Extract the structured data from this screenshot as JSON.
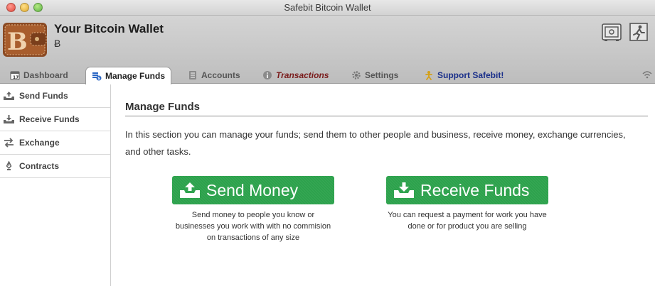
{
  "window": {
    "title": "Safebit Bitcoin Wallet"
  },
  "header": {
    "title": "Your Bitcoin Wallet",
    "balance": "Ƀ",
    "icons": [
      "wallet-icon",
      "safe-icon",
      "exit-icon"
    ]
  },
  "tabs": [
    {
      "label": "Dashboard",
      "icon": "calendar-icon"
    },
    {
      "label": "Manage Funds",
      "icon": "funds-icon",
      "active": true
    },
    {
      "label": "Accounts",
      "icon": "ledger-icon"
    },
    {
      "label": "Transactions",
      "icon": "info-icon"
    },
    {
      "label": "Settings",
      "icon": "gear-icon"
    },
    {
      "label": "Support Safebit!",
      "icon": "person-icon"
    }
  ],
  "sidebar": {
    "items": [
      {
        "label": "Send Funds",
        "icon": "send-tray-icon"
      },
      {
        "label": "Receive Funds",
        "icon": "receive-tray-icon"
      },
      {
        "label": "Exchange",
        "icon": "exchange-icon"
      },
      {
        "label": "Contracts",
        "icon": "pen-icon"
      }
    ]
  },
  "main": {
    "title": "Manage Funds",
    "description": "In this section you can manage your funds; send them to other people and business, receive money, exchange currencies, and other tasks.",
    "send": {
      "label": "Send Money",
      "caption": "Send money to people you know or businesses you work with with no commision on transactions of any size"
    },
    "receive": {
      "label": "Receive Funds",
      "caption": "You can request a payment for work you have done or for product you are selling"
    }
  },
  "colors": {
    "action_green": "#2ba14b",
    "transactions_tab": "#7a1b1b",
    "support_tab": "#1a2f8a"
  }
}
